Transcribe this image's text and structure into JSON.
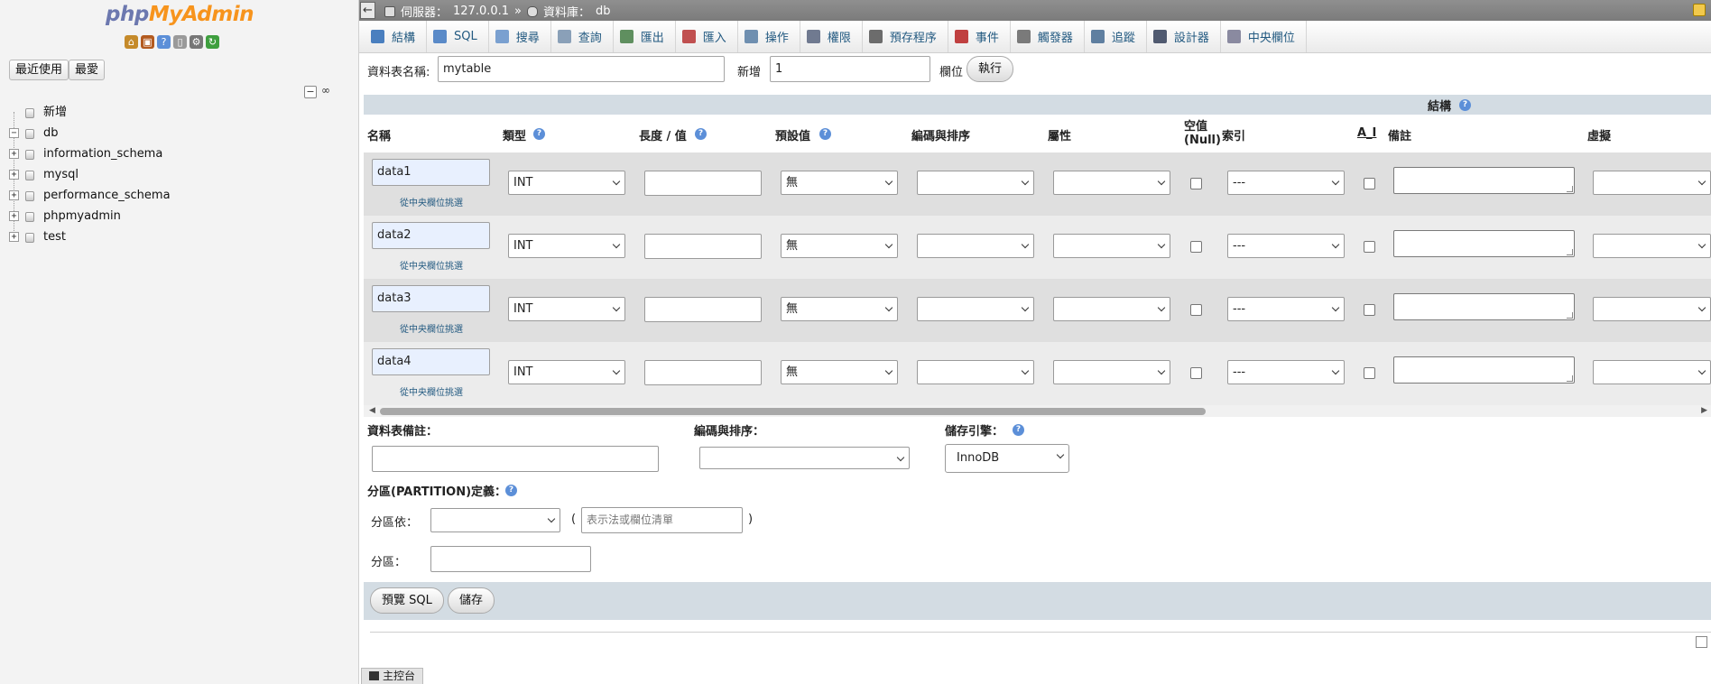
{
  "nav": {
    "logo_php": "php",
    "logo_myadmin": "MyAdmin",
    "icons": [
      {
        "name": "home-icon",
        "color": "#c58a2a",
        "glyph": "⌂"
      },
      {
        "name": "logout-icon",
        "color": "#b35a1f",
        "glyph": "▣"
      },
      {
        "name": "help-icon",
        "color": "#5c8fd8",
        "glyph": "?"
      },
      {
        "name": "docs-icon",
        "color": "#9a9a9a",
        "glyph": "▯"
      },
      {
        "name": "settings-icon",
        "color": "#777777",
        "glyph": "⚙"
      },
      {
        "name": "reload-icon",
        "color": "#3f9f3f",
        "glyph": "↻"
      }
    ],
    "recent_label": "最近使用",
    "favorites_label": "最愛",
    "tree": [
      {
        "label": "新增",
        "expander": ""
      },
      {
        "label": "db",
        "expander": "−"
      },
      {
        "label": "information_schema",
        "expander": "+"
      },
      {
        "label": "mysql",
        "expander": "+"
      },
      {
        "label": "performance_schema",
        "expander": "+"
      },
      {
        "label": "phpmyadmin",
        "expander": "+"
      },
      {
        "label": "test",
        "expander": "+"
      }
    ]
  },
  "topbar": {
    "server_label": "伺服器：",
    "server": "127.0.0.1",
    "separator": "»",
    "db_label": "資料庫：",
    "db": "db"
  },
  "tabs": [
    {
      "label": "結構",
      "icon": "structure-icon",
      "color": "#4a7fbf"
    },
    {
      "label": "SQL",
      "icon": "sql-icon",
      "color": "#5a8ac8"
    },
    {
      "label": "搜尋",
      "icon": "search-icon",
      "color": "#7aa0d0"
    },
    {
      "label": "查詢",
      "icon": "query-icon",
      "color": "#8aa0b8"
    },
    {
      "label": "匯出",
      "icon": "export-icon",
      "color": "#5f8f5f"
    },
    {
      "label": "匯入",
      "icon": "import-icon",
      "color": "#c05050"
    },
    {
      "label": "操作",
      "icon": "operations-icon",
      "color": "#6f8fb0"
    },
    {
      "label": "權限",
      "icon": "privileges-icon",
      "color": "#707a90"
    },
    {
      "label": "預存程序",
      "icon": "routines-icon",
      "color": "#6c6c6c"
    },
    {
      "label": "事件",
      "icon": "events-icon",
      "color": "#c04040"
    },
    {
      "label": "觸發器",
      "icon": "triggers-icon",
      "color": "#7a7a7a"
    },
    {
      "label": "追蹤",
      "icon": "tracking-icon",
      "color": "#5f7fa0"
    },
    {
      "label": "設計器",
      "icon": "designer-icon",
      "color": "#505a70"
    },
    {
      "label": "中央欄位",
      "icon": "central-columns-icon",
      "color": "#8a8aa0"
    }
  ],
  "table_form": {
    "name_label": "資料表名稱:",
    "name_value": "mytable",
    "add_label": "新增",
    "add_value": "1",
    "columns_label": "欄位",
    "go_label": "執行"
  },
  "structure": {
    "title": "結構",
    "headers": {
      "name": "名稱",
      "type": "類型",
      "length": "長度 / 值",
      "default": "預設值",
      "collation": "編碼與排序",
      "attributes": "屬性",
      "null_line1": "空值",
      "null_line2": "(Null)",
      "index": "索引",
      "ai": "A_I",
      "comments": "備註",
      "virtuality": "虛擬"
    },
    "pick_label": "從中央欄位挑選",
    "rows": [
      {
        "name": "data1",
        "type": "INT",
        "default": "無",
        "index": "---"
      },
      {
        "name": "data2",
        "type": "INT",
        "default": "無",
        "index": "---"
      },
      {
        "name": "data3",
        "type": "INT",
        "default": "無",
        "index": "---"
      },
      {
        "name": "data4",
        "type": "INT",
        "default": "無",
        "index": "---"
      }
    ]
  },
  "table_options": {
    "comments_label": "資料表備註：",
    "collation_label": "編碼與排序：",
    "engine_label": "儲存引擎：",
    "engine_value": "InnoDB",
    "partition_label": "分區(PARTITION)定義：",
    "partition_by_label": "分區依：",
    "paren_open": "(",
    "expression_placeholder": "表示法或欄位清單",
    "paren_close": ")",
    "partitions_label": "分區："
  },
  "actions": {
    "preview_sql": "預覽 SQL",
    "save": "儲存"
  },
  "console": {
    "label": "主控台"
  }
}
